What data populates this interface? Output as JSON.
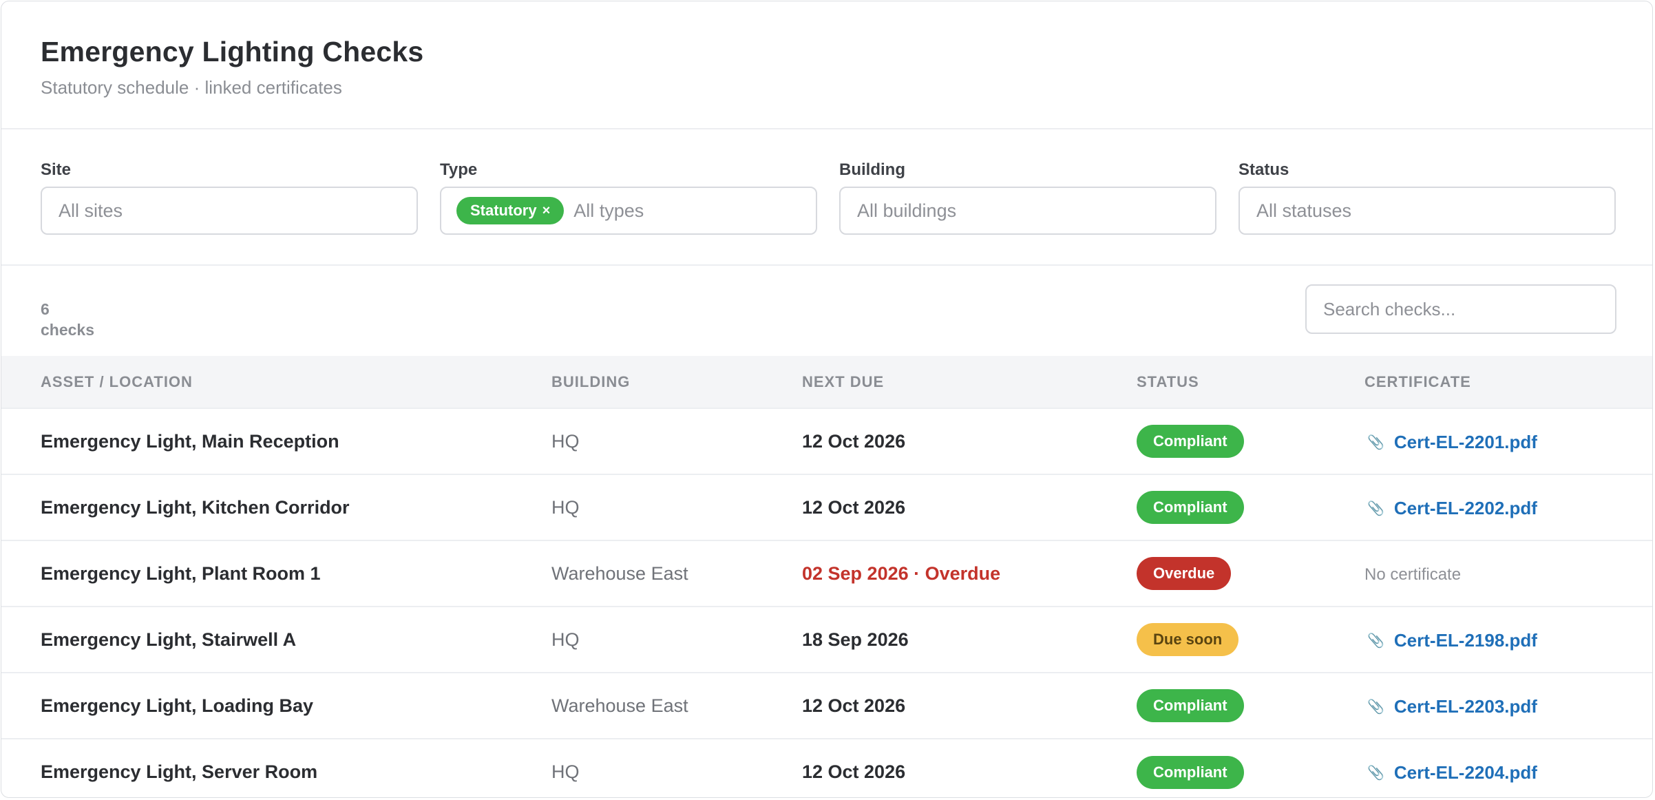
{
  "header": {
    "title": "Emergency Lighting Checks",
    "subtitle": "Statutory schedule · linked certificates"
  },
  "filters": [
    {
      "label": "Site",
      "placeholder": "All sites",
      "chip": null
    },
    {
      "label": "Type",
      "placeholder": "All types",
      "chip": "Statutory"
    },
    {
      "label": "Building",
      "placeholder": "All buildings",
      "chip": null
    },
    {
      "label": "Status",
      "placeholder": "All statuses",
      "chip": null
    }
  ],
  "chip_remove": "×",
  "toolbar": {
    "count": "6",
    "count_label": "checks",
    "search_placeholder": "Search checks..."
  },
  "table": {
    "columns": [
      "ASSET / LOCATION",
      "BUILDING",
      "NEXT DUE",
      "STATUS",
      "CERTIFICATE"
    ],
    "rows": [
      {
        "asset": "Emergency Light, Main Reception",
        "building": "HQ",
        "due": "12 Oct 2026",
        "status": "Compliant",
        "status_kind": "compliant",
        "certificate": "Cert-EL-2201.pdf"
      },
      {
        "asset": "Emergency Light, Kitchen Corridor",
        "building": "HQ",
        "due": "12 Oct 2026",
        "status": "Compliant",
        "status_kind": "compliant",
        "certificate": "Cert-EL-2202.pdf"
      },
      {
        "asset": "Emergency Light, Plant Room 1",
        "building": "Warehouse East",
        "due": "02 Sep 2026 · Overdue",
        "status": "Overdue",
        "status_kind": "overdue",
        "certificate": null,
        "no_certificate": "No certificate"
      },
      {
        "asset": "Emergency Light, Stairwell A",
        "building": "HQ",
        "due": "18 Sep 2026",
        "status": "Due soon",
        "status_kind": "soon",
        "certificate": "Cert-EL-2198.pdf"
      },
      {
        "asset": "Emergency Light, Loading Bay",
        "building": "Warehouse East",
        "due": "12 Oct 2026",
        "status": "Compliant",
        "status_kind": "compliant",
        "certificate": "Cert-EL-2203.pdf"
      },
      {
        "asset": "Emergency Light, Server Room",
        "building": "HQ",
        "due": "12 Oct 2026",
        "status": "Compliant",
        "status_kind": "compliant",
        "certificate": "Cert-EL-2204.pdf"
      }
    ]
  },
  "colors": {
    "compliant": "#3db54a",
    "overdue": "#c3332b",
    "due_soon": "#f5c04a",
    "link": "#1f6fb8"
  },
  "icons": {
    "certificate": "paperclip-icon"
  }
}
